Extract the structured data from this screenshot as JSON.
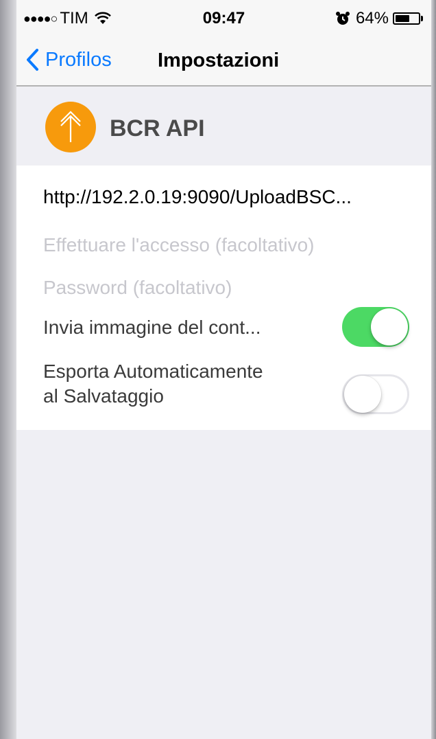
{
  "status_bar": {
    "signal": "●●●●○",
    "carrier": "TIM",
    "time": "09:47",
    "battery_percent": "64%",
    "battery_level": 0.64,
    "icons": [
      "wifi-icon",
      "alarm-icon",
      "battery-icon"
    ]
  },
  "nav": {
    "back_label": "Profilos",
    "title": "Impostazioni"
  },
  "profile": {
    "name": "BCR API",
    "icon": "upload-arrow-icon",
    "icon_color": "#f79a0c"
  },
  "settings": {
    "url": "http://192.2.0.19:9090/UploadBSC...",
    "login_placeholder": "Effettuare l'accesso (facoltativo)",
    "password_placeholder": "Password (facoltativo)",
    "send_image_label": "Invia immagine del cont...",
    "send_image_on": true,
    "auto_export_label_line1": "Esporta Automaticamente",
    "auto_export_label_line2": "al Salvataggio",
    "auto_export_on": false
  },
  "colors": {
    "accent": "#0a7aff",
    "toggle_on": "#4cd964",
    "placeholder": "#c7c7cd"
  }
}
